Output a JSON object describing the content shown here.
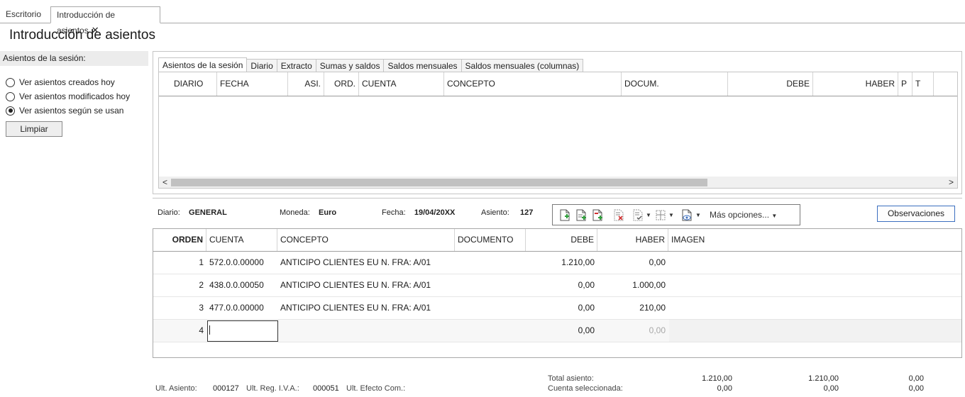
{
  "tabs": {
    "escritorio": "Escritorio",
    "introduccion": "Introducción de asientos",
    "close_glyph": "✕"
  },
  "page_title": "Introducción de asientos",
  "left": {
    "header": "Asientos de la sesión:",
    "options": [
      {
        "label": "Ver asientos creados hoy",
        "checked": false
      },
      {
        "label": "Ver asientos modificados hoy",
        "checked": false
      },
      {
        "label": "Ver asientos según se usan",
        "checked": true
      }
    ],
    "clear_button": "Limpiar"
  },
  "upper": {
    "tabs": [
      "Asientos de la sesión",
      "Diario",
      "Extracto",
      "Sumas y saldos",
      "Saldos mensuales",
      "Saldos mensuales (columnas)"
    ],
    "active_tab": 0,
    "columns": [
      "DIARIO",
      "FECHA",
      "ASI.",
      "ORD.",
      "CUENTA",
      "CONCEPTO",
      "DOCUM.",
      "DEBE",
      "HABER",
      "P",
      "T"
    ],
    "scroll_left": "<",
    "scroll_right": ">"
  },
  "info": {
    "diario_label": "Diario:",
    "diario_value": "GENERAL",
    "moneda_label": "Moneda:",
    "moneda_value": "Euro",
    "fecha_label": "Fecha:",
    "fecha_value": "19/04/20XX",
    "asiento_label": "Asiento:",
    "asiento_value": "127"
  },
  "toolbar": {
    "more_options": "Más opciones...",
    "icons": [
      "new-entry-icon",
      "duplicate-entry-icon",
      "insert-line-icon",
      "delete-entry-icon",
      "check-entry-icon",
      "split-view-icon",
      "preview-icon"
    ]
  },
  "observaciones_button": "Observaciones",
  "lower": {
    "columns": [
      "ORDEN",
      "CUENTA",
      "CONCEPTO",
      "DOCUMENTO",
      "DEBE",
      "HABER",
      "IMAGEN"
    ],
    "rows": [
      {
        "orden": "1",
        "cuenta": "572.0.0.00000",
        "concepto": "ANTICIPO CLIENTES EU N. FRA:  A/01",
        "debe": "1.210,00",
        "haber": "0,00"
      },
      {
        "orden": "2",
        "cuenta": "438.0.0.00050",
        "concepto": "ANTICIPO CLIENTES EU N. FRA:  A/01",
        "debe": "0,00",
        "haber": "1.000,00"
      },
      {
        "orden": "3",
        "cuenta": "477.0.0.00000",
        "concepto": "ANTICIPO CLIENTES EU N. FRA:  A/01",
        "debe": "0,00",
        "haber": "210,00"
      }
    ],
    "new_row": {
      "orden": "4",
      "debe": "0,00",
      "haber": "0,00"
    }
  },
  "footer": {
    "ult_asiento_label": "Ult. Asiento:",
    "ult_asiento_value": "000127",
    "ult_iva_label": "Ult. Reg. I.V.A.:",
    "ult_iva_value": "000051",
    "ult_efecto_label": "Ult. Efecto Com.:",
    "total_label": "Total asiento:",
    "cuenta_label": "Cuenta seleccionada:",
    "total_debe": "1.210,00",
    "total_haber": "1.210,00",
    "total_saldo": "0,00",
    "cuenta_debe": "0,00",
    "cuenta_haber": "0,00",
    "cuenta_saldo": "0,00"
  },
  "colors": {
    "accent_border": "#3b6fc0",
    "add_icon_green": "#2e9e3a",
    "delete_icon_red": "#d03030"
  }
}
